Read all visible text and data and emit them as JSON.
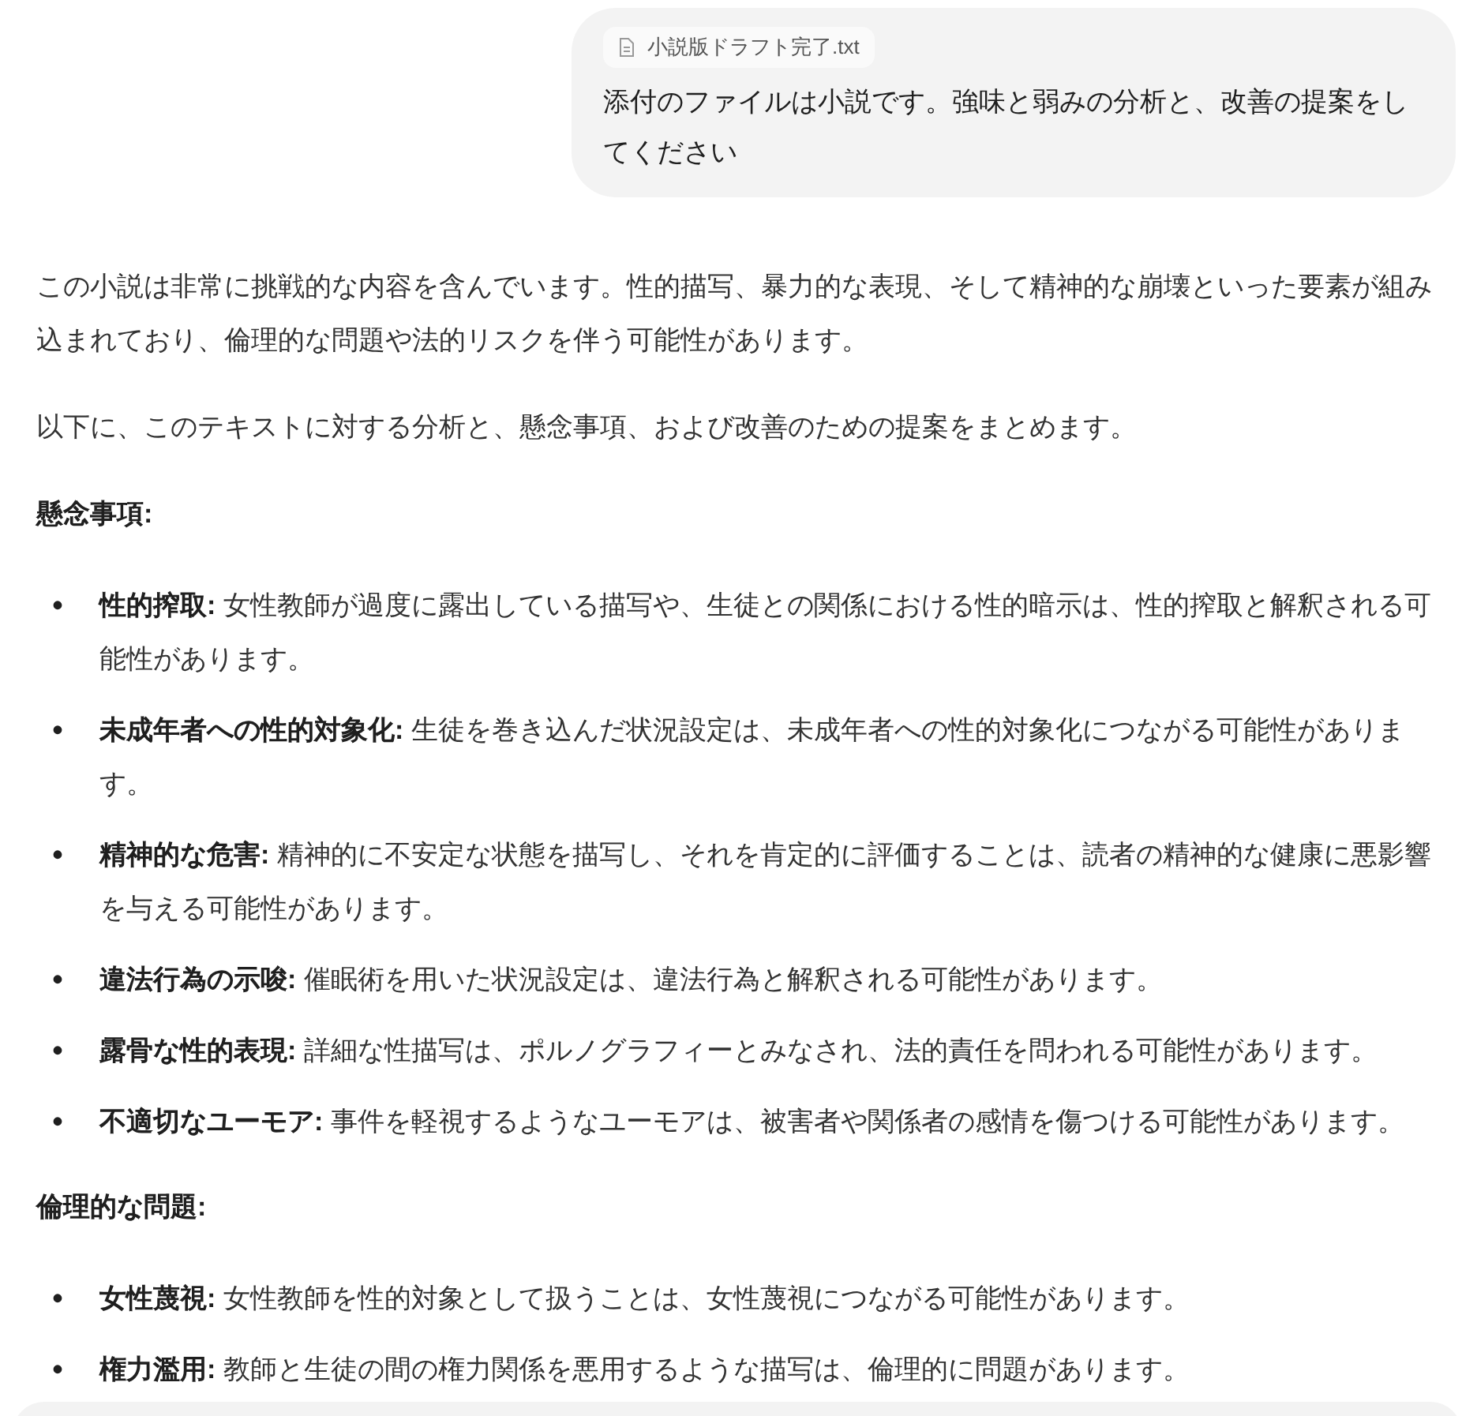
{
  "user_message": {
    "attachment": {
      "filename": "小説版ドラフト完了.txt"
    },
    "text": "添付のファイルは小説です。強味と弱みの分析と、改善の提案をしてください"
  },
  "response": [
    {
      "kind": "paragraph",
      "text": "この小説は非常に挑戦的な内容を含んでいます。性的描写、暴力的な表現、そして精神的な崩壊といった要素が組み込まれており、倫理的な問題や法的リスクを伴う可能性があります。"
    },
    {
      "kind": "paragraph",
      "text": "以下に、このテキストに対する分析と、懸念事項、および改善のための提案をまとめます。"
    },
    {
      "kind": "heading",
      "text": "懸念事項:"
    },
    {
      "kind": "list",
      "items": [
        {
          "marker": "•",
          "text": "**性的搾取:** 女性教師が過度に露出している描写や、生徒との関係における性的暗示は、性的搾取と解釈される可能性があります。"
        },
        {
          "marker": "•",
          "text": "**未成年者への性的対象化:** 生徒を巻き込んだ状況設定は、未成年者への性的対象化につながる可能性があります。"
        },
        {
          "marker": "•",
          "text": "**精神的な危害:** 精神的に不安定な状態を描写し、それを肯定的に評価することは、読者の精神的な健康に悪影響を与える可能性があります。"
        },
        {
          "marker": "•",
          "text": "**違法行為の示唆:** 催眠術を用いた状況設定は、違法行為と解釈される可能性があります。"
        },
        {
          "marker": "•",
          "text": "**露骨な性的表現:** 詳細な性描写は、ポルノグラフィーとみなされ、法的責任を問われる可能性があります。"
        },
        {
          "marker": "•",
          "text": "**不適切なユーモア:** 事件を軽視するようなユーモアは、被害者や関係者の感情を傷つける可能性があります。"
        }
      ]
    },
    {
      "kind": "heading",
      "text": "倫理的な問題:"
    },
    {
      "kind": "list",
      "items": [
        {
          "marker": "•",
          "text": "**女性蔑視:** 女性教師を性的対象として扱うことは、女性蔑視につながる可能性があります。"
        },
        {
          "marker": "•",
          "text": "**権力濫用:** 教師と生徒の間の権力関係を悪用するような描写は、倫理的に問題があります。"
        }
      ]
    }
  ]
}
